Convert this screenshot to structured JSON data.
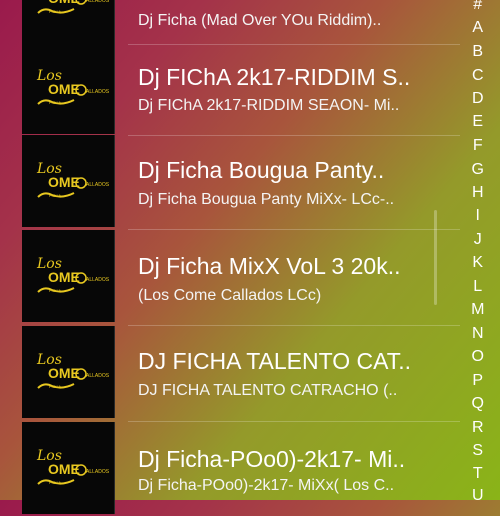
{
  "list": {
    "items": [
      {
        "title": "",
        "subtitle": "Dj Ficha (Mad Over YOu Riddim)..",
        "thumb_logo_text": "Los Come Callados Ficha"
      },
      {
        "title": "Dj FIChA 2k17-RIDDIM S..",
        "subtitle": "Dj FIChA 2k17-RIDDIM SEAON- Mi..",
        "thumb_logo_text": "Los Come Callados Ficha"
      },
      {
        "title": "Dj Ficha Bougua Panty..",
        "subtitle": "Dj Ficha Bougua Panty MiXx- LCc-..",
        "thumb_logo_text": "Los Come Callados Ficha"
      },
      {
        "title": "Dj Ficha MixX VoL 3 20k..",
        "subtitle": "(Los Come Callados LCc)",
        "thumb_logo_text": "Los Come Callados Ficha"
      },
      {
        "title": "DJ FICHA TALENTO CAT..",
        "subtitle": "DJ FICHA TALENTO CATRACHO (..",
        "thumb_logo_text": "Los Come Callados Ficha"
      },
      {
        "title": "Dj Ficha-POo0)-2k17- Mi..",
        "subtitle": "Dj Ficha-POo0)-2k17- MiXx( Los C..",
        "thumb_logo_text": "Los Come Callados Ficha"
      }
    ]
  },
  "alphabet_index": [
    "#",
    "A",
    "B",
    "C",
    "D",
    "E",
    "F",
    "G",
    "H",
    "I",
    "J",
    "K",
    "L",
    "M",
    "N",
    "O",
    "P",
    "Q",
    "R",
    "S",
    "T",
    "U"
  ],
  "colors": {
    "gradient_magenta": "#9a1a4c",
    "gradient_green": "#8ab418",
    "thumb_bg": "#070707",
    "logo_yellow": "#e8c820",
    "text": "#ffffff"
  }
}
